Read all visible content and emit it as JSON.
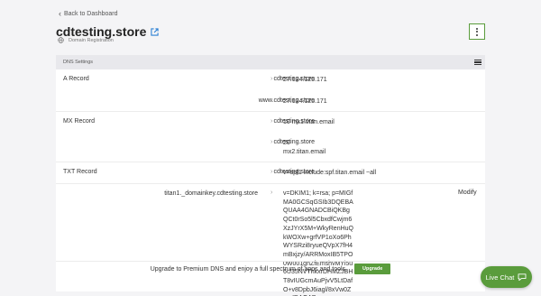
{
  "nav": {
    "back_label": "Back to Dashboard"
  },
  "domain": {
    "name": "cdtesting.store",
    "subtitle": "Domain Registration"
  },
  "panel": {
    "header": "DNS Settings"
  },
  "records": {
    "a_type": "A Record",
    "a1_host": "cdtesting.store",
    "a1_value": "27.124.125.171",
    "a2_host": "www.cdtesting.store",
    "a2_value": "27.124.125.171",
    "mx_type": "MX Record",
    "mx1_host": "cdtesting.store",
    "mx1_value": "10  mx1.titan.email",
    "mx2_host": "cdtesting.store",
    "mx2_priority": "20",
    "mx2_value": "mx2.titan.email",
    "txt_type": "TXT Record",
    "txt1_host": "cdtesting.store",
    "txt1_value": "v=spf1 include:spf.titan.email ~all",
    "txt2_host": "titan1._domainkey.cdtesting.store",
    "txt2_value": "v=DKIM1; k=rsa; p=MIGfMA0GCSqGSIb3DQEBAQUAA4GNADCBiQKBgQCt0rSo5l5CbxdfCwjm6XzJYrX5M+WkyRenHuQkWOXw+grfVP1oXo6PhWYSRzi8ryueQVpX7fH4mBxjzy/ARRMoxIB5TPO0W001gnZfEmshvMYi5u6U35NVThkxrDHMZJBHT8vIUGcmAuPjvV5LtDafO+v8DpbJ6iagl/8xVw0ZwwIDAQAB",
    "modify_label": "Modify",
    "arrow": "›"
  },
  "upgrade": {
    "text": "Upgrade to Premium DNS and enjoy a full spectrum of apps and tools.",
    "button": "Upgrade"
  },
  "chat": {
    "label": "Live Chat"
  },
  "colors": {
    "accent": "#5a9c3c",
    "panel_header": "#e8e8ec",
    "background": "#f4f4f6"
  },
  "icons": {
    "back": "chevron-left-icon",
    "external": "external-link-icon",
    "globe": "globe-icon",
    "kebab": "kebab-menu-icon",
    "menu": "hamburger-menu-icon",
    "chat": "chat-bubble-icon"
  }
}
